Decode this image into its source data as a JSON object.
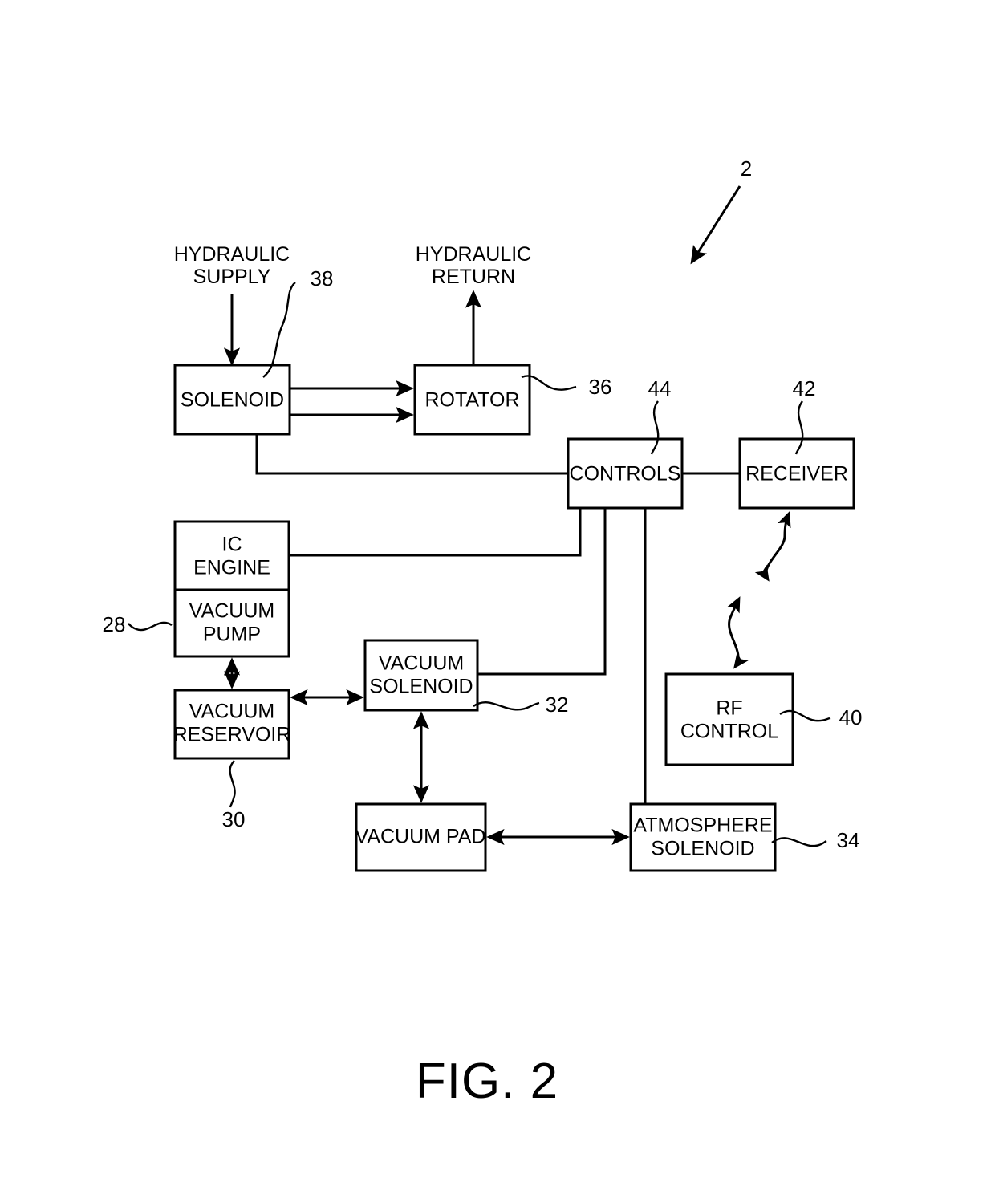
{
  "figure": {
    "caption": "FIG. 2",
    "system_ref": "2"
  },
  "free_labels": [
    {
      "id": "hydraulic-supply",
      "line1": "HYDRAULIC",
      "line2": "SUPPLY"
    },
    {
      "id": "hydraulic-return",
      "line1": "HYDRAULIC",
      "line2": "RETURN"
    }
  ],
  "blocks": [
    {
      "id": "solenoid",
      "line1": "SOLENOID",
      "line2": "",
      "ref": "38"
    },
    {
      "id": "rotator",
      "line1": "ROTATOR",
      "line2": "",
      "ref": "36"
    },
    {
      "id": "controls",
      "line1": "CONTROLS",
      "line2": "",
      "ref": "44"
    },
    {
      "id": "receiver",
      "line1": "RECEIVER",
      "line2": "",
      "ref": "42"
    },
    {
      "id": "ic-engine",
      "line1": "IC",
      "line2": "ENGINE",
      "ref": ""
    },
    {
      "id": "vacuum-pump",
      "line1": "VACUUM",
      "line2": "PUMP",
      "ref": "28"
    },
    {
      "id": "vacuum-reservoir",
      "line1": "VACUUM",
      "line2": "RESERVOIR",
      "ref": "30"
    },
    {
      "id": "vacuum-solenoid",
      "line1": "VACUUM",
      "line2": "SOLENOID",
      "ref": "32"
    },
    {
      "id": "rf-control",
      "line1": "RF",
      "line2": "CONTROL",
      "ref": "40"
    },
    {
      "id": "vacuum-pad",
      "line1": "VACUUM PAD",
      "line2": "",
      "ref": ""
    },
    {
      "id": "atmosphere-solenoid",
      "line1": "ATMOSPHERE",
      "line2": "SOLENOID",
      "ref": "34"
    }
  ],
  "reference_numerals": {
    "system": "2",
    "solenoid": "38",
    "rotator": "36",
    "controls": "44",
    "receiver": "42",
    "vacuum_pump": "28",
    "vacuum_reservoir": "30",
    "vacuum_solenoid": "32",
    "rf_control": "40",
    "atmosphere_solenoid": "34"
  },
  "colors": {
    "ink": "#000000",
    "paper": "#ffffff"
  }
}
